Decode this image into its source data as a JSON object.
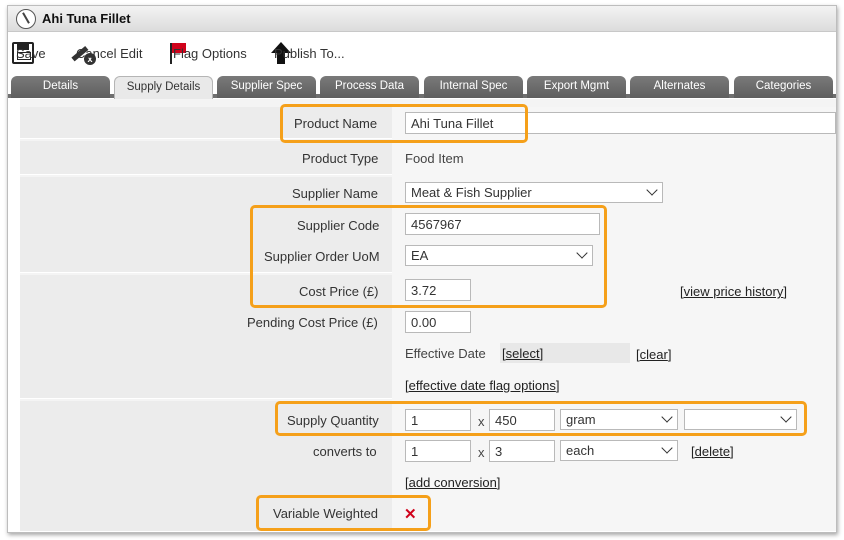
{
  "window": {
    "title": "Ahi Tuna Fillet"
  },
  "toolbar": {
    "save": "Save",
    "cancel_edit": "Cancel Edit",
    "flag_options": "Flag Options",
    "publish_to": "Publish To..."
  },
  "tabs": [
    {
      "label": "Details"
    },
    {
      "label": "Supply Details",
      "active": true
    },
    {
      "label": "Supplier Spec"
    },
    {
      "label": "Process Data"
    },
    {
      "label": "Internal Spec"
    },
    {
      "label": "Export Mgmt"
    },
    {
      "label": "Alternates"
    },
    {
      "label": "Categories"
    }
  ],
  "form": {
    "product_name": {
      "label": "Product Name",
      "value": "Ahi Tuna Fillet"
    },
    "product_type": {
      "label": "Product Type",
      "value": "Food Item"
    },
    "supplier_name": {
      "label": "Supplier Name",
      "value": "Meat & Fish Supplier"
    },
    "supplier_code": {
      "label": "Supplier Code",
      "value": "4567967"
    },
    "supplier_order_uom": {
      "label": "Supplier Order UoM",
      "value": "EA"
    },
    "cost_price": {
      "label": "Cost Price (£)",
      "value": "3.72",
      "link": "view price history"
    },
    "pending_cost_price": {
      "label": "Pending Cost Price (£)",
      "value": "0.00"
    },
    "effective_date": {
      "label": "Effective Date",
      "select": "select",
      "clear": "clear",
      "flag_options": "effective date flag options"
    },
    "supply_quantity": {
      "label": "Supply Quantity",
      "qty": "1",
      "times": "x",
      "amount": "450",
      "unit": "gram",
      "extra": ""
    },
    "converts_to": {
      "label": "converts to",
      "qty": "1",
      "times": "x",
      "amount": "3",
      "unit": "each",
      "delete": "delete",
      "add": "add conversion"
    },
    "variable_weighted": {
      "label": "Variable Weighted",
      "value": "✕"
    }
  },
  "colors": {
    "highlight": "#f5a01a",
    "tab_bg": "#6a6a6a",
    "flag_red": "#d0021b"
  }
}
